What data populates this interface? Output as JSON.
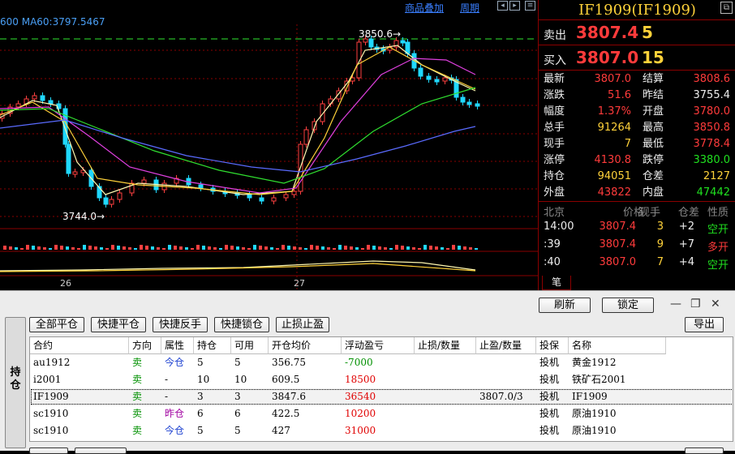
{
  "chart": {
    "ma_legend": "600  MA60:3797.5467",
    "links": {
      "overlay": "商品叠加",
      "period": "周期"
    },
    "high_marker": "3850.6",
    "low_marker": "3744.0",
    "date_labels": [
      "26",
      "27"
    ]
  },
  "quote": {
    "title": "IF1909(IF1909)",
    "ask_label": "卖出",
    "ask_price": "3807.4",
    "ask_vol": "5",
    "bid_label": "买入",
    "bid_price": "3807.0",
    "bid_vol": "15",
    "stats": [
      {
        "l1": "最新",
        "v1": "3807.0",
        "c1": "#ff3b3b",
        "l2": "结算",
        "v2": "3808.6",
        "c2": "#ff3b3b"
      },
      {
        "l1": "涨跌",
        "v1": "51.6",
        "c1": "#ff3b3b",
        "l2": "昨结",
        "v2": "3755.4",
        "c2": "#eeeeee"
      },
      {
        "l1": "幅度",
        "v1": "1.37%",
        "c1": "#ff3b3b",
        "l2": "开盘",
        "v2": "3780.0",
        "c2": "#ff3b3b"
      },
      {
        "l1": "总手",
        "v1": "91264",
        "c1": "#ffd23a",
        "l2": "最高",
        "v2": "3850.8",
        "c2": "#ff3b3b"
      },
      {
        "l1": "现手",
        "v1": "7",
        "c1": "#ffd23a",
        "l2": "最低",
        "v2": "3778.4",
        "c2": "#ff3b3b"
      },
      {
        "l1": "涨停",
        "v1": "4130.8",
        "c1": "#ff3b3b",
        "l2": "跌停",
        "v2": "3380.0",
        "c2": "#20e020"
      },
      {
        "l1": "持仓",
        "v1": "94051",
        "c1": "#ffd23a",
        "l2": "仓差",
        "v2": "2127",
        "c2": "#ffd23a"
      },
      {
        "l1": "外盘",
        "v1": "43822",
        "c1": "#ff3b3b",
        "l2": "内盘",
        "v2": "47442",
        "c2": "#20e020"
      }
    ],
    "tick_header": [
      "北京",
      "价格",
      "现手",
      "仓差",
      "性质"
    ],
    "ticks": [
      {
        "time": "14:00",
        "price": "3807.4",
        "vol": "3",
        "oi": "+2",
        "nature": "空开",
        "nature_color": "#20e020"
      },
      {
        "time": ":39",
        "price": "3807.4",
        "vol": "9",
        "oi": "+7",
        "nature": "多开",
        "nature_color": "#ff3b3b"
      },
      {
        "time": ":40",
        "price": "3807.0",
        "vol": "7",
        "oi": "+4",
        "nature": "空开",
        "nature_color": "#20e020"
      }
    ],
    "pen_tab": "笔"
  },
  "positions": {
    "refresh": "刷新",
    "lock": "锁定",
    "buttons": [
      "全部平仓",
      "快捷平仓",
      "快捷反手",
      "快捷锁仓",
      "止损止盈"
    ],
    "export": "导出",
    "side_tab": "持仓",
    "headers": [
      "合约",
      "方向",
      "属性",
      "持仓",
      "可用",
      "开仓均价",
      "浮动盈亏",
      "止损/数量",
      "止盈/数量",
      "投保",
      "名称"
    ],
    "rows": [
      {
        "contract": "au1912",
        "dir": "卖",
        "attr": "今仓",
        "attr_color": "#1a3fd0",
        "pos": "5",
        "avail": "5",
        "avg": "356.75",
        "pnl": "-7000",
        "pnl_color": "#009000",
        "sl": "",
        "tp": "",
        "hedge": "投机",
        "name": "黄金1912",
        "selected": false
      },
      {
        "contract": "i2001",
        "dir": "卖",
        "attr": "-",
        "attr_color": "#000000",
        "pos": "10",
        "avail": "10",
        "avg": "609.5",
        "pnl": "18500",
        "pnl_color": "#e00000",
        "sl": "",
        "tp": "",
        "hedge": "投机",
        "name": "铁矿石2001",
        "selected": false
      },
      {
        "contract": "IF1909",
        "dir": "卖",
        "attr": "-",
        "attr_color": "#000000",
        "pos": "3",
        "avail": "3",
        "avg": "3847.6",
        "pnl": "36540",
        "pnl_color": "#e00000",
        "sl": "",
        "tp": "3807.0/3",
        "hedge": "投机",
        "name": "IF1909",
        "selected": true
      },
      {
        "contract": "sc1910",
        "dir": "卖",
        "attr": "昨仓",
        "attr_color": "#a000a0",
        "pos": "6",
        "avail": "6",
        "avg": "422.5",
        "pnl": "10200",
        "pnl_color": "#e00000",
        "sl": "",
        "tp": "",
        "hedge": "投机",
        "name": "原油1910",
        "selected": false
      },
      {
        "contract": "sc1910",
        "dir": "卖",
        "attr": "今仓",
        "attr_color": "#1a3fd0",
        "pos": "5",
        "avail": "5",
        "avg": "427",
        "pnl": "31000",
        "pnl_color": "#e00000",
        "sl": "",
        "tp": "",
        "hedge": "投机",
        "name": "原油1910",
        "selected": false
      }
    ]
  }
}
